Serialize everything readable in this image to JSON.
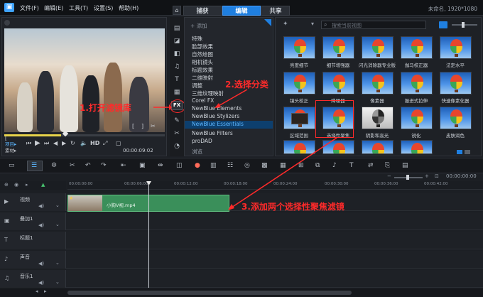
{
  "menubar": {
    "items": [
      "文件(F)",
      "编辑(E)",
      "工具(T)",
      "设置(S)",
      "帮助(H)"
    ],
    "tabs": [
      "捕获",
      "编辑",
      "共享"
    ],
    "active_tab": "编辑",
    "project_info": "未命名, 1920*1080"
  },
  "player": {
    "mode_project": "项目▸",
    "mode_clip": "素材▸",
    "hd_label": "HD",
    "timecode": "00:00:09:02",
    "volume_value": "00:00:00:00"
  },
  "fx_column": {
    "fx_label": "FX"
  },
  "category_panel": {
    "add_label": "添加",
    "categories": [
      "特殊",
      "脸部效果",
      "自然绘图",
      "相机镜头",
      "标题效果",
      "二维映射",
      "调整",
      "三维纹理映射",
      "Corel FX",
      "NewBlue Elements",
      "NewBlue Stylizers",
      "NewBlue Essentials",
      "NewBlue Filters",
      "proDAD",
      "浏览"
    ],
    "selected": "NewBlue Essentials"
  },
  "thumb_panel": {
    "search_placeholder": "搜索当前视图",
    "filters": [
      "亮度细节",
      "细节增强器",
      "闪光消除器专业版",
      "伽马校正器",
      "法定水平",
      "镜头校正",
      "降噪器",
      "像素器",
      "振进式拉伸",
      "快速像素化器",
      "区域范围",
      "选择性聚焦",
      "阴影和高光",
      "锐化",
      "皮肤润色"
    ]
  },
  "timeline": {
    "ruler_ticks": [
      "00:00:00:00",
      "00:00:06:00",
      "00:00:12:00",
      "00:00:18:00",
      "00:00:24:00",
      "00:00:30:00",
      "00:00:36:00",
      "00:00:42:00"
    ],
    "tracks": [
      "视频",
      "叠加1",
      "标题1",
      "声音",
      "音乐1"
    ],
    "clip_name": "小狗V视.mp4",
    "zoom_label": "H"
  },
  "annotations": {
    "step1": "1.打开滤镜库",
    "step2": "2.选择分类",
    "step3": "3.添加两个选择性聚焦滤镜"
  },
  "colors": {
    "accent": "#1f7fe0",
    "annotation": "#ff2a2a",
    "clip": "#3a8f5a"
  }
}
